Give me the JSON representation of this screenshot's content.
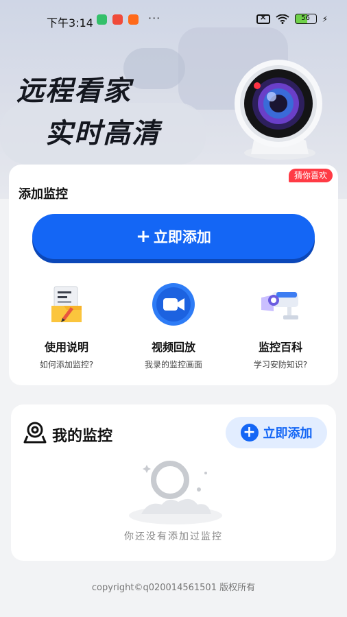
{
  "status_bar": {
    "time": "下午3:14",
    "dots": "···",
    "battery": "56"
  },
  "hero": {
    "slogan_line1": "远程看家",
    "slogan_line2": "实时高清"
  },
  "add_card": {
    "tag": "猜你喜欢",
    "title": "添加监控",
    "add_button_plus": "+",
    "add_button_label": "立即添加",
    "features": [
      {
        "icon": "manual-icon",
        "title": "使用说明",
        "subtitle": "如何添加监控?"
      },
      {
        "icon": "video-icon",
        "title": "视频回放",
        "subtitle": "我录的监控画面"
      },
      {
        "icon": "camera-icon",
        "title": "监控百科",
        "subtitle": "学习安防知识?"
      }
    ]
  },
  "my_monitor": {
    "title": "我的监控",
    "add_plus": "+",
    "add_label": "立即添加",
    "empty_text": "你还没有添加过监控"
  },
  "footer": {
    "copyright": "copyright©q020014561501 版权所有"
  },
  "colors": {
    "primary": "#1466f5",
    "tag_red": "#ff3b45",
    "background": "#f2f3f5"
  }
}
